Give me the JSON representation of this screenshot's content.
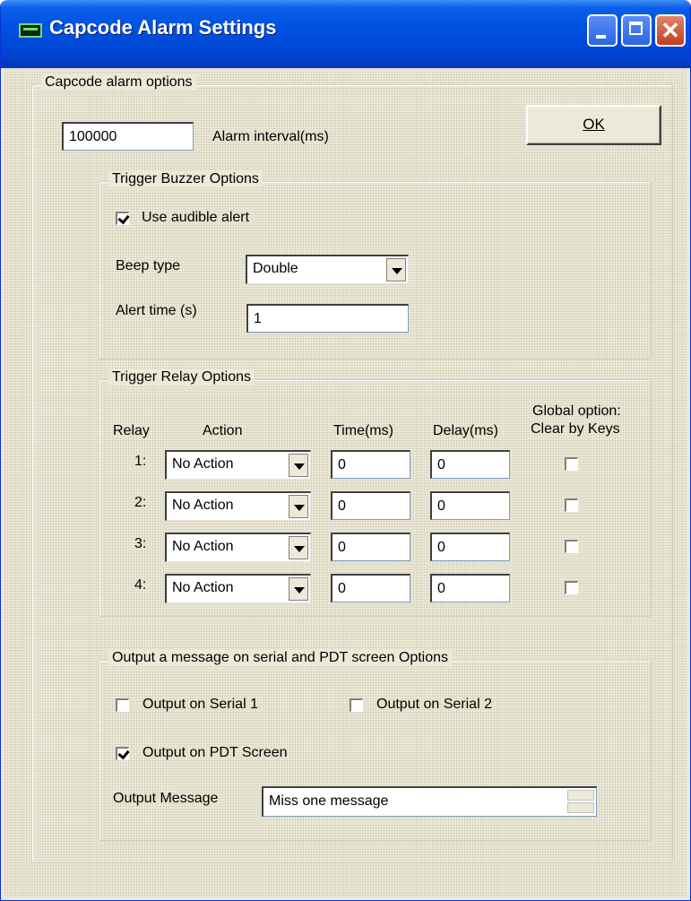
{
  "window": {
    "title": "Capcode Alarm Settings"
  },
  "capcode_options": {
    "legend": "Capcode alarm options",
    "alarm_interval_value": "100000",
    "alarm_interval_label": "Alarm interval(ms)",
    "ok_label": "OK"
  },
  "buzzer": {
    "legend": "Trigger Buzzer Options",
    "use_audible_alert_label": "Use audible alert",
    "use_audible_alert_checked": true,
    "beep_type_label": "Beep type",
    "beep_type_value": "Double",
    "alert_time_label": "Alert time (s)",
    "alert_time_value": "1"
  },
  "relay": {
    "legend": "Trigger Relay Options",
    "headers": {
      "relay": "Relay",
      "action": "Action",
      "time": "Time(ms)",
      "delay": "Delay(ms)",
      "global_line1": "Global option:",
      "global_line2": "Clear by Keys"
    },
    "rows": [
      {
        "num": "1:",
        "action": "No Action",
        "time": "0",
        "delay": "0",
        "clear": false
      },
      {
        "num": "2:",
        "action": "No Action",
        "time": "0",
        "delay": "0",
        "clear": false
      },
      {
        "num": "3:",
        "action": "No Action",
        "time": "0",
        "delay": "0",
        "clear": false
      },
      {
        "num": "4:",
        "action": "No Action",
        "time": "0",
        "delay": "0",
        "clear": false
      }
    ]
  },
  "output": {
    "legend": "Output a message on serial and PDT screen Options",
    "serial1_label": "Output on Serial 1",
    "serial1_checked": false,
    "serial2_label": "Output on Serial 2",
    "serial2_checked": false,
    "pdt_label": "Output on PDT Screen",
    "pdt_checked": true,
    "message_label": "Output Message",
    "message_value": "Miss one message"
  }
}
